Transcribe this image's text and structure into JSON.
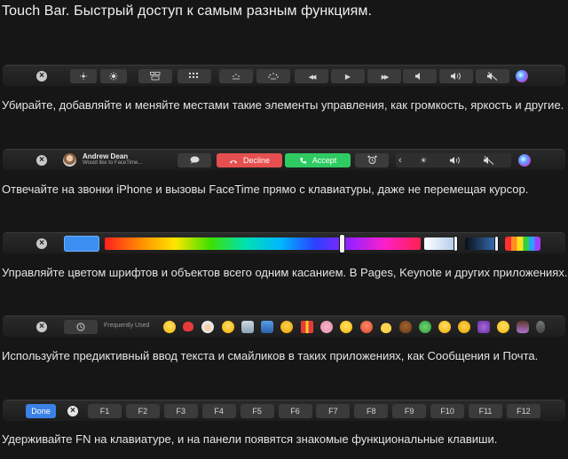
{
  "heading": "Touch Bar. Быстрый доступ к самым разным функциям.",
  "rows": [
    {
      "caption": "Убирайте, добавляйте и меняйте местами такие элементы управления, как громкость, яркость и другие."
    },
    {
      "caller_name": "Andrew Dean",
      "caller_subtitle": "Would like to FaceTime...",
      "decline_label": "Decline",
      "accept_label": "Accept",
      "caption": "Отвечайте на звонки iPhone и вызовы FaceTime прямо с клавиатуры, даже не перемещая курсор."
    },
    {
      "caption": "Управляйте цветом шрифтов и объектов всего одним касанием. В Pages, Keynote и других приложениях.",
      "slider_position_fraction": 0.75
    },
    {
      "frequently_used_label": "Frequently Used",
      "caption": "Используйте предиктивный ввод текста и смайликов в таких приложениях, как Сообщения и Почта."
    },
    {
      "done_label": "Done",
      "fkeys": [
        "F1",
        "F2",
        "F3",
        "F4",
        "F5",
        "F6",
        "F7",
        "F8",
        "F9",
        "F10",
        "F11",
        "F12"
      ],
      "caption": "Удерживайте FN на клавиатуре, и на панели появятся знакомые функциональные клавиши."
    }
  ],
  "glyphs": {
    "close": "×",
    "brightness": "☀",
    "rewind": "◀◀",
    "play": "▶",
    "fast_forward": "▶▶",
    "volume": "🔈",
    "chevron": "‹"
  },
  "colors": {
    "background": "#161616",
    "decline": "#e64f4f",
    "accept": "#2ecb62",
    "done": "#3b82e6"
  }
}
